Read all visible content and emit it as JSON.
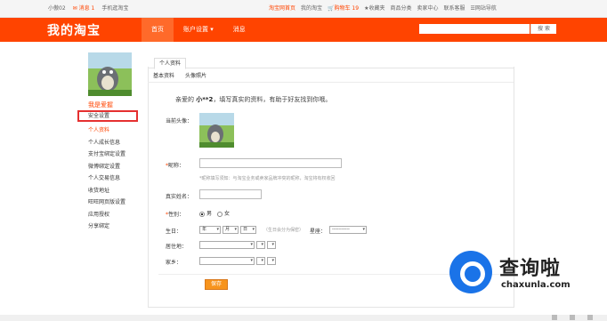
{
  "topbar": {
    "user": "小傲02",
    "messages": "消息 1",
    "mobile": "手机逛淘宝",
    "links": [
      "淘宝网首页",
      "我的淘宝",
      "购物车 19",
      "收藏夹",
      "商品分类",
      "卖家中心",
      "联系客服",
      "网站导航"
    ]
  },
  "nav": {
    "logo": "我的淘宝",
    "items": [
      "首页",
      "账户设置",
      "消息"
    ],
    "search_button": "搜 索"
  },
  "sidebar": {
    "title": "我是爱握",
    "security": "安全设置",
    "items": [
      "个人资料",
      "个人成长信息",
      "支付宝绑定设置",
      "微博绑定设置",
      "个人交易信息",
      "收货地址",
      "旺旺网页版设置",
      "应用授权",
      "分享绑定"
    ]
  },
  "main": {
    "tab": "个人资料",
    "subtabs": [
      "基本资料",
      "头像照片"
    ],
    "greeting_prefix": "亲爱的",
    "greeting_name": "小**2",
    "greeting_suffix": "，填写真实的资料，有助于好友找到你哦。",
    "avatar_label": "当前头像：",
    "nickname_label": "昵称：",
    "nickname_hint": "*昵称填写须知：与淘宝业务或卖家品牌冲突的昵称，淘宝将有权收回",
    "realname_label": "真实姓名：",
    "gender_label": "性别：",
    "gender_male": "男",
    "gender_female": "女",
    "birthday_label": "生日：",
    "year": "年",
    "month": "月",
    "day": "日",
    "birthday_hint": "（生日会分为保密）",
    "zodiac_label": "星座：",
    "zodiac_value": "-----------",
    "residence_label": "居住地：",
    "hometown_label": "家乡：",
    "save_button": "保存"
  },
  "watermark": {
    "text": "查询啦",
    "url": "chaxunla.com"
  }
}
